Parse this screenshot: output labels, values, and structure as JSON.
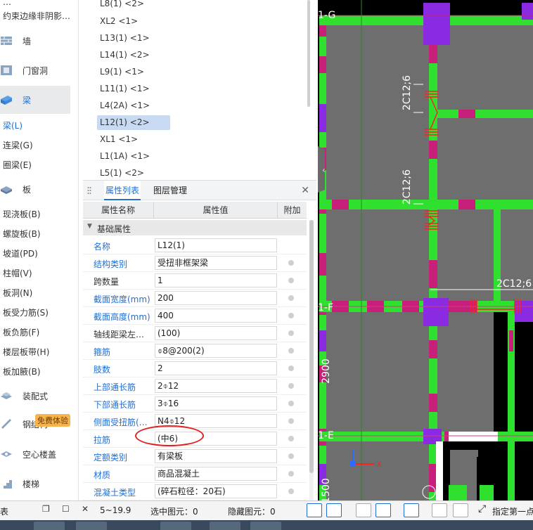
{
  "left_nav": {
    "top_items": [
      {
        "label": "约束边缘非阴影…"
      }
    ],
    "categories": [
      {
        "label": "墙",
        "icon": "wall-icon"
      },
      {
        "label": "门窗洞",
        "icon": "door-window-icon"
      },
      {
        "label": "梁",
        "icon": "beam-icon",
        "active": true
      },
      {
        "label": "板",
        "icon": "slab-icon"
      },
      {
        "label": "装配式",
        "icon": "prefab-icon"
      },
      {
        "label": "钢结构",
        "icon": "steel-icon"
      },
      {
        "label": "空心楼盖",
        "icon": "hollow-floor-icon"
      },
      {
        "label": "楼梯",
        "icon": "stair-icon"
      }
    ],
    "beam_items": [
      "梁(L)",
      "连梁(G)",
      "圈梁(E)"
    ],
    "slab_items": [
      "现浇板(B)",
      "螺旋板(B)",
      "坡道(PD)",
      "柱帽(V)",
      "板洞(N)",
      "板受力筋(S)",
      "板负筋(F)",
      "楼层板带(H)",
      "板加腋(B)"
    ],
    "badge": "免费体验"
  },
  "component_list": {
    "items": [
      "L8(1) <2>",
      "XL2 <1>",
      "L13(1) <1>",
      "L14(1) <2>",
      "L9(1) <1>",
      "L11(1) <1>",
      "L4(2A) <1>",
      "L12(1) <2>",
      "XL1 <1>",
      "L1(1A) <1>",
      "L5(1) <2>"
    ],
    "selected_index": 7
  },
  "property_panel": {
    "tabs": [
      "属性列表",
      "图层管理"
    ],
    "active_tab": 0,
    "columns": {
      "name": "属性名称",
      "value": "属性值",
      "extra": "附加"
    },
    "group": "基础属性",
    "rows": [
      {
        "name": "名称",
        "value": "L12(1)",
        "blue": true,
        "check": false
      },
      {
        "name": "结构类别",
        "value": "受扭非框架梁",
        "blue": true,
        "check": true
      },
      {
        "name": "跨数量",
        "value": "1",
        "blue": false,
        "check": true
      },
      {
        "name": "截面宽度(mm)",
        "value": "200",
        "blue": true,
        "check": true
      },
      {
        "name": "截面高度(mm)",
        "value": "400",
        "blue": true,
        "check": true
      },
      {
        "name": "轴线距梁左…",
        "value": "(100)",
        "blue": false,
        "check": true
      },
      {
        "name": "箍筋",
        "value": "⌽8@200(2)",
        "blue": true,
        "check": true
      },
      {
        "name": "肢数",
        "value": "2",
        "blue": true,
        "check": true
      },
      {
        "name": "上部通长筋",
        "value": "2⌽12",
        "blue": true,
        "check": true
      },
      {
        "name": "下部通长筋",
        "value": "3⌽16",
        "blue": true,
        "check": true
      },
      {
        "name": "侧面受扭筋(…",
        "value": "N4⌽12",
        "blue": true,
        "check": true
      },
      {
        "name": "拉筋",
        "value": "(中6)",
        "blue": true,
        "check": true
      },
      {
        "name": "定额类别",
        "value": "有梁板",
        "blue": true,
        "check": true
      },
      {
        "name": "材质",
        "value": "商品混凝土",
        "blue": true,
        "check": true
      },
      {
        "name": "混凝土类型",
        "value": "(碎石粒径：20石)",
        "blue": true,
        "check": true
      }
    ]
  },
  "canvas": {
    "axis_labels": [
      "1-G",
      "1-F",
      "1-E"
    ],
    "dimensions": [
      "2900",
      "1500"
    ],
    "rebar_labels": [
      "2C12;6",
      "2C12;6",
      "2C12;6"
    ],
    "colors": {
      "background": "#000000",
      "slab": "#6e6e6e",
      "beam": "#2fe02f",
      "wall": "#c8207a",
      "column": "#8a2be2",
      "rebar": "#ff2020"
    }
  },
  "status_bar": {
    "panel_title": "表",
    "coord_text": "5~19.9",
    "selected": "选中图元：0",
    "hidden": "隐藏图元：0",
    "hint": "指定第一点"
  }
}
